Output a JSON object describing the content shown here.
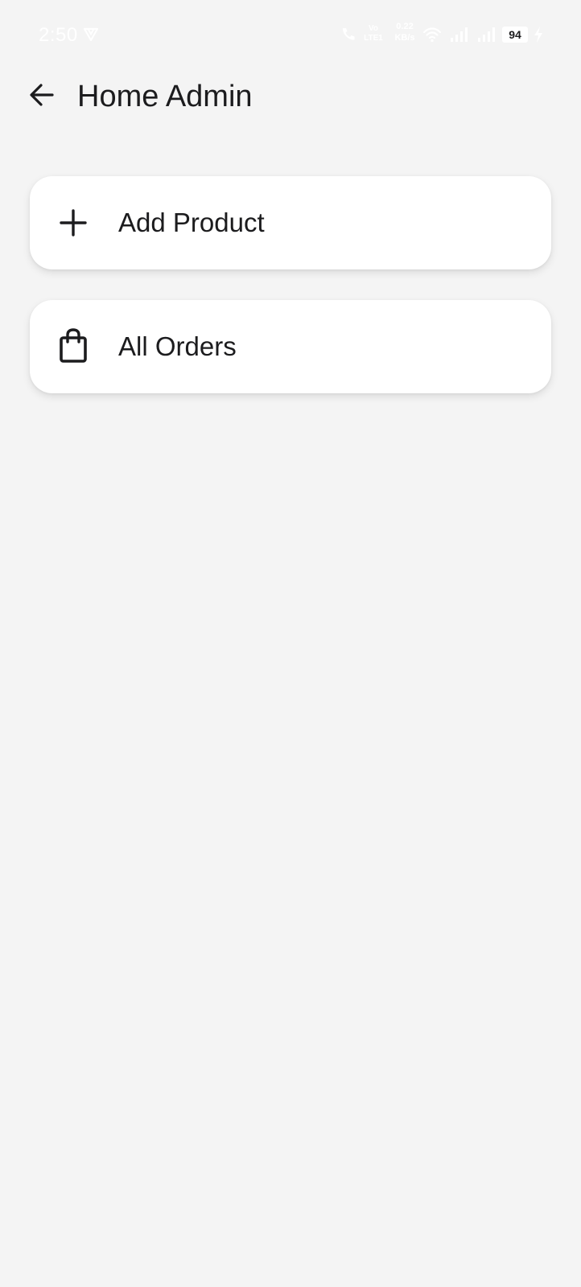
{
  "status_bar": {
    "time": "2:50",
    "volte_top": "Vo",
    "volte_bottom": "LTE1",
    "speed_value": "0.22",
    "speed_unit": "KB/s",
    "battery_level": "94",
    "icons": [
      "vpn-icon",
      "wifi-call-icon",
      "wifi-icon",
      "signal-icon",
      "signal-icon",
      "battery-icon",
      "charging-icon"
    ]
  },
  "app_bar": {
    "back_icon": "arrow-left-icon",
    "title": "Home Admin"
  },
  "menu": {
    "items": [
      {
        "icon": "plus-icon",
        "label": "Add Product"
      },
      {
        "icon": "shopping-bag-icon",
        "label": "All Orders"
      }
    ]
  },
  "colors": {
    "background": "#f4f4f4",
    "card": "#ffffff",
    "text": "#1c1c1e"
  }
}
